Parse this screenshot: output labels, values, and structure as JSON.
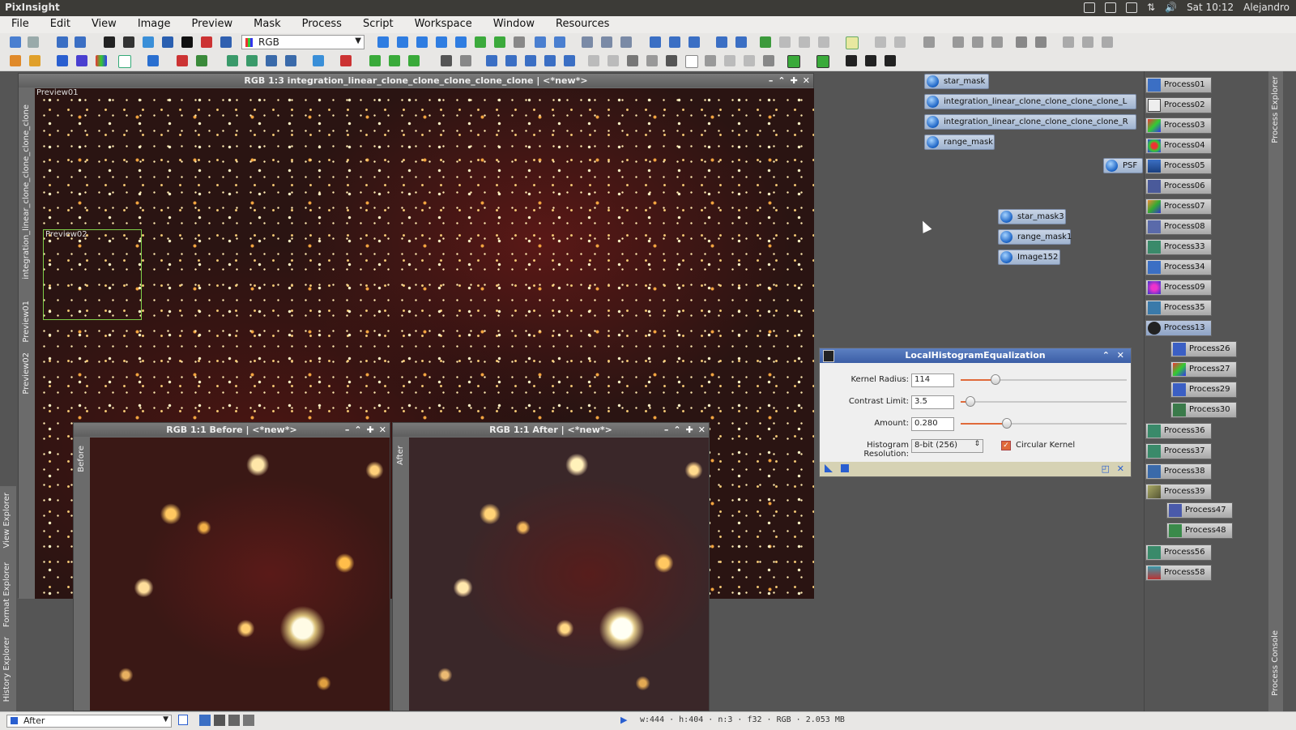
{
  "app": {
    "title": "PixInsight"
  },
  "system_tray": {
    "time": "Sat 10:12",
    "user": "Alejandro"
  },
  "menu": [
    "File",
    "Edit",
    "View",
    "Image",
    "Preview",
    "Mask",
    "Process",
    "Script",
    "Workspace",
    "Window",
    "Resources"
  ],
  "toolbar": {
    "channel_select": "RGB"
  },
  "main_window": {
    "title": "RGB 1:3 integration_linear_clone_clone_clone_clone_clone | <*new*>",
    "side_label": "integration_linear_clone_clone_clone_clone",
    "side_tabs": [
      "Preview01",
      "Preview02"
    ],
    "previews": [
      "Preview01",
      "Preview02"
    ]
  },
  "before_window": {
    "title": "RGB 1:1 Before | <*new*>",
    "side_label": "Before"
  },
  "after_window": {
    "title": "RGB 1:1 After | <*new*>",
    "side_label": "After"
  },
  "image_icons": [
    "star_mask",
    "integration_linear_clone_clone_clone_clone_L",
    "integration_linear_clone_clone_clone_clone_R",
    "range_mask",
    "PSF",
    "star_mask3",
    "range_mask1",
    "Image152"
  ],
  "process_icons": [
    "Process01",
    "Process02",
    "Process03",
    "Process04",
    "Process05",
    "Process06",
    "Process07",
    "Process08",
    "Process33",
    "Process34",
    "Process09",
    "Process35",
    "Process13",
    "Process26",
    "Process27",
    "Process29",
    "Process30",
    "Process36",
    "Process37",
    "Process38",
    "Process39",
    "Process47",
    "Process48",
    "Process56",
    "Process58"
  ],
  "lhe_dialog": {
    "title": "LocalHistogramEqualization",
    "kernel_radius_label": "Kernel Radius:",
    "kernel_radius": "114",
    "contrast_limit_label": "Contrast Limit:",
    "contrast_limit": "3.5",
    "amount_label": "Amount:",
    "amount": "0.280",
    "histogram_resolution_label": "Histogram Resolution:",
    "histogram_resolution": "8-bit (256)",
    "circular_kernel_label": "Circular Kernel",
    "circular_kernel_checked": true
  },
  "left_panels": [
    "View Explorer",
    "Format Explorer",
    "History Explorer"
  ],
  "right_panels": [
    "Process Explorer",
    "Process Console"
  ],
  "statusbar": {
    "view": "After",
    "info": "w:444 · h:404 · n:3 · f32 · RGB · 2.053 MB"
  }
}
